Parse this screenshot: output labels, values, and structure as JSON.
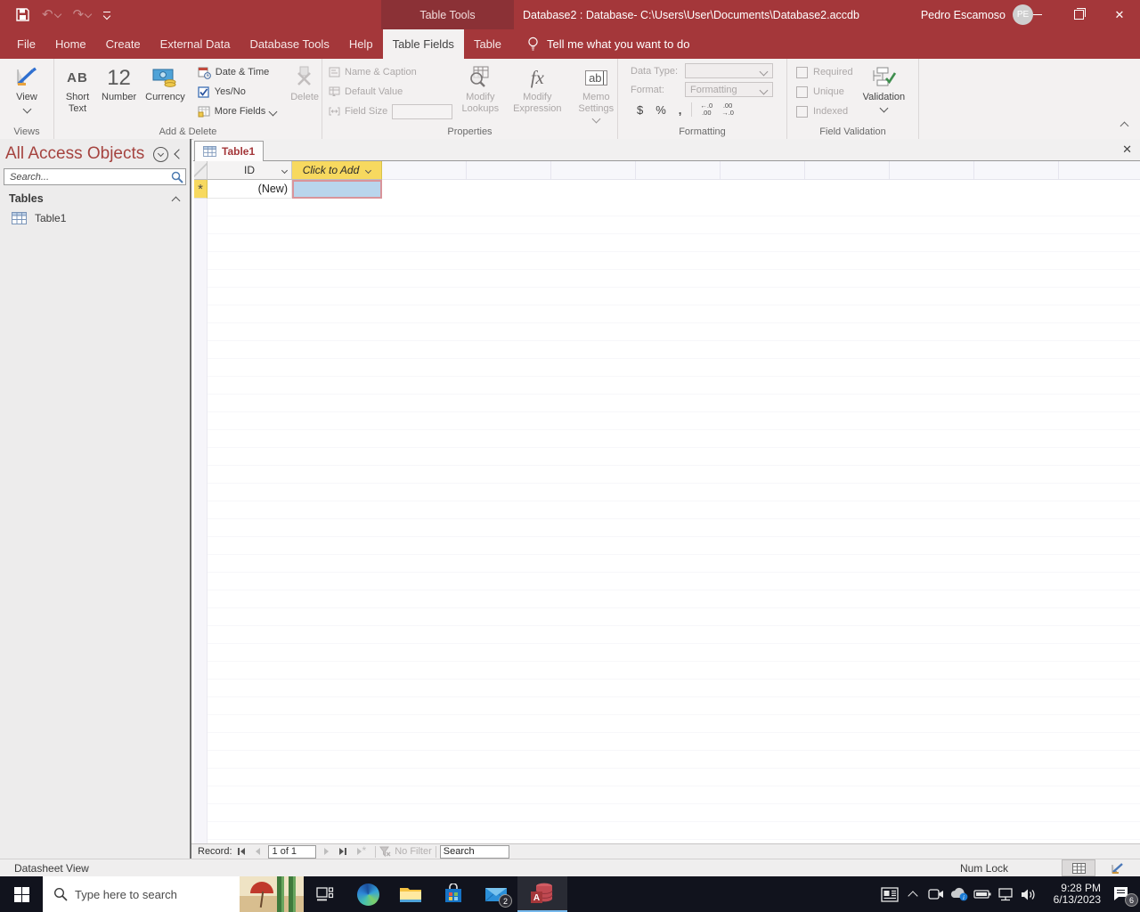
{
  "glyphs": {
    "undo": "↶",
    "redo": "↷",
    "window_close": "✕",
    "doc_close": "✕",
    "new_row_asterisk": "*"
  },
  "window": {
    "contextual_group": "Table Tools",
    "title": "Database2 : Database- C:\\Users\\User\\Documents\\Database2.accdb (Acce...",
    "user_name": "Pedro Escamoso",
    "user_initials": "PE"
  },
  "menu": {
    "tabs": [
      "File",
      "Home",
      "Create",
      "External Data",
      "Database Tools",
      "Help",
      "Table Fields",
      "Table"
    ],
    "tell_me": "Tell me what you want to do"
  },
  "ribbon": {
    "views": {
      "view": "View",
      "label": "Views"
    },
    "add_delete": {
      "short_text_glyph": "AB",
      "short_text": "Short Text",
      "number_glyph": "12",
      "number": "Number",
      "currency": "Currency",
      "date_time": "Date & Time",
      "yes_no": "Yes/No",
      "more_fields": "More Fields",
      "delete": "Delete",
      "label": "Add & Delete"
    },
    "properties": {
      "name_caption": "Name & Caption",
      "default_value": "Default Value",
      "field_size": "Field Size",
      "modify_lookups": "Modify Lookups",
      "modify_expression": "Modify Expression",
      "memo_settings": "Memo Settings",
      "fx_glyph": "fx",
      "memo_glyph": "ab",
      "label": "Properties"
    },
    "formatting": {
      "data_type": "Data Type:",
      "format": "Format:",
      "format_value": "Formatting",
      "dollar": "$",
      "percent": "%",
      "comma": ",",
      "inc_top": "←.0",
      "inc_bottom": ".00",
      "dec_top": ".00",
      "dec_bottom": "→.0",
      "label": "Formatting"
    },
    "validation": {
      "required": "Required",
      "unique": "Unique",
      "indexed": "Indexed",
      "validation": "Validation",
      "label": "Field Validation"
    }
  },
  "sidebar": {
    "title": "All Access Objects",
    "search_placeholder": "Search...",
    "group_label": "Tables",
    "items": [
      {
        "label": "Table1"
      }
    ]
  },
  "document": {
    "tab_label": "Table1",
    "columns": [
      {
        "name": "ID"
      },
      {
        "name": "Click to Add"
      }
    ],
    "new_row_value": "(New)"
  },
  "record_nav": {
    "label": "Record:",
    "position": "1 of 1",
    "no_filter": "No Filter",
    "search": "Search"
  },
  "status_bar": {
    "view_name": "Datasheet View",
    "num_lock": "Num Lock"
  },
  "taskbar": {
    "search_placeholder": "Type here to search",
    "mail_badge": "2",
    "time": "9:28 PM",
    "date": "6/13/2023",
    "notifications": "6"
  }
}
